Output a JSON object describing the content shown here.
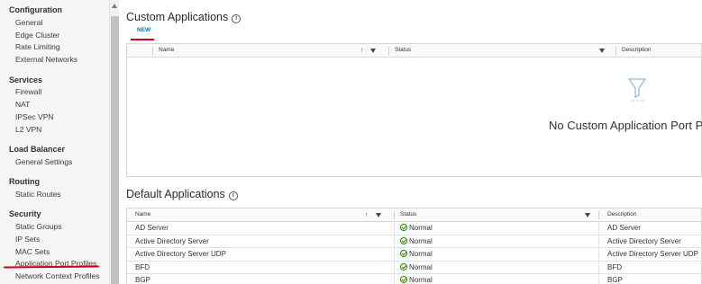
{
  "sidebar": {
    "sections": [
      {
        "title": "Configuration",
        "items": [
          "General",
          "Edge Cluster",
          "Rate Limiting",
          "External Networks"
        ]
      },
      {
        "title": "Services",
        "items": [
          "Firewall",
          "NAT",
          "IPSec VPN",
          "L2 VPN"
        ]
      },
      {
        "title": "Load Balancer",
        "items": [
          "General Settings"
        ]
      },
      {
        "title": "Routing",
        "items": [
          "Static Routes"
        ]
      },
      {
        "title": "Security",
        "items": [
          "Static Groups",
          "IP Sets",
          "MAC Sets",
          "Application Port Profiles",
          "Network Context Profiles"
        ]
      }
    ],
    "selected_item": "Application Port Profiles"
  },
  "custom_apps": {
    "title": "Custom Applications",
    "new_label": "NEW",
    "columns": [
      "Name",
      "Status",
      "Description"
    ],
    "empty_message": "No Custom Application Port Pro"
  },
  "default_apps": {
    "title": "Default Applications",
    "columns": [
      "Name",
      "Status",
      "Description"
    ],
    "rows": [
      {
        "name": "AD Server",
        "status": "Normal",
        "description": "AD Server"
      },
      {
        "name": "Active Directory Server",
        "status": "Normal",
        "description": "Active Directory Server"
      },
      {
        "name": "Active Directory Server UDP",
        "status": "Normal",
        "description": "Active Directory Server UDP"
      },
      {
        "name": "BFD",
        "status": "Normal",
        "description": "BFD"
      },
      {
        "name": "BGP",
        "status": "Normal",
        "description": "BGP"
      }
    ]
  },
  "colors": {
    "accent_link": "#0079b8",
    "annotation_red": "#d0021b",
    "status_ok": "#2f8400"
  },
  "icons": {
    "info": "info-icon",
    "sort": "sort-arrow-icon",
    "filter": "filter-icon",
    "empty": "funnel-icon",
    "status_ok": "check-circle-icon"
  }
}
